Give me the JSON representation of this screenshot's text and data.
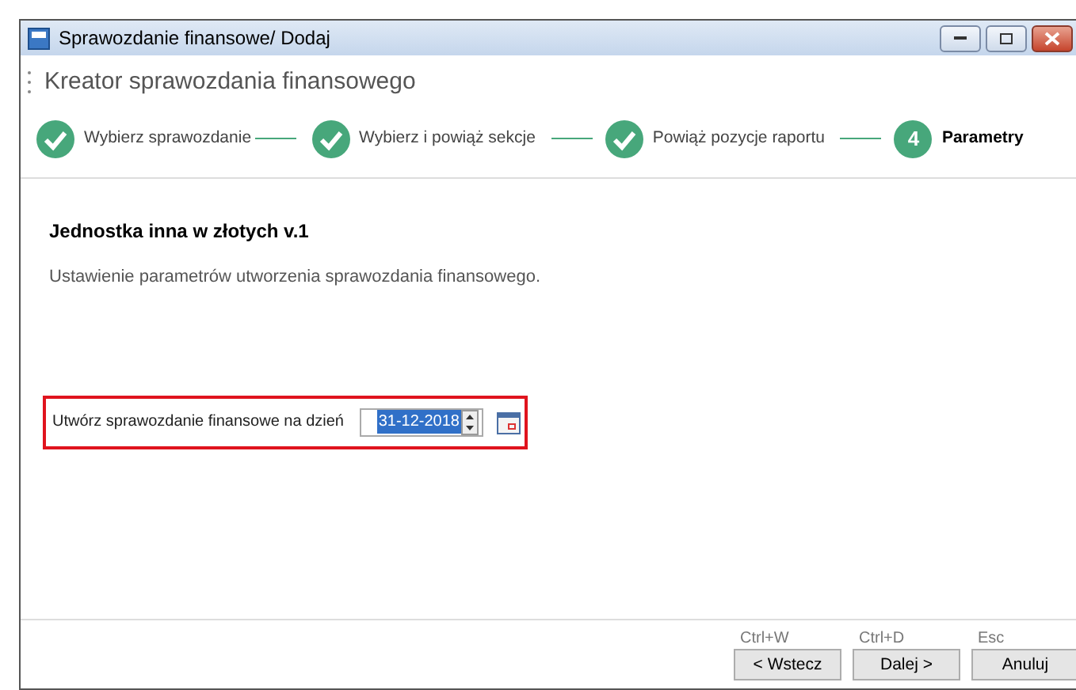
{
  "window": {
    "title": "Sprawozdanie finansowe/ Dodaj"
  },
  "wizard_title": "Kreator sprawozdania finansowego",
  "steps": [
    {
      "label": "Wybierz sprawozdanie",
      "kind": "done",
      "selected": false
    },
    {
      "label": "Wybierz i powiąż sekcje",
      "kind": "done",
      "selected": false
    },
    {
      "label": "Powiąż pozycje raportu",
      "kind": "done",
      "selected": false
    },
    {
      "label": "Parametry",
      "kind": "number",
      "number": "4",
      "selected": true
    }
  ],
  "heading": "Jednostka inna w złotych v.1",
  "description": "Ustawienie parametrów utworzenia sprawozdania finansowego.",
  "date_field": {
    "label": "Utwórz sprawozdanie finansowe na dzień",
    "value": "31-12-2018",
    "highlighted": true
  },
  "buttons": [
    {
      "shortcut": "Ctrl+W",
      "label": "< Wstecz"
    },
    {
      "shortcut": "Ctrl+D",
      "label": "Dalej >"
    },
    {
      "shortcut": "Esc",
      "label": "Anuluj"
    }
  ]
}
